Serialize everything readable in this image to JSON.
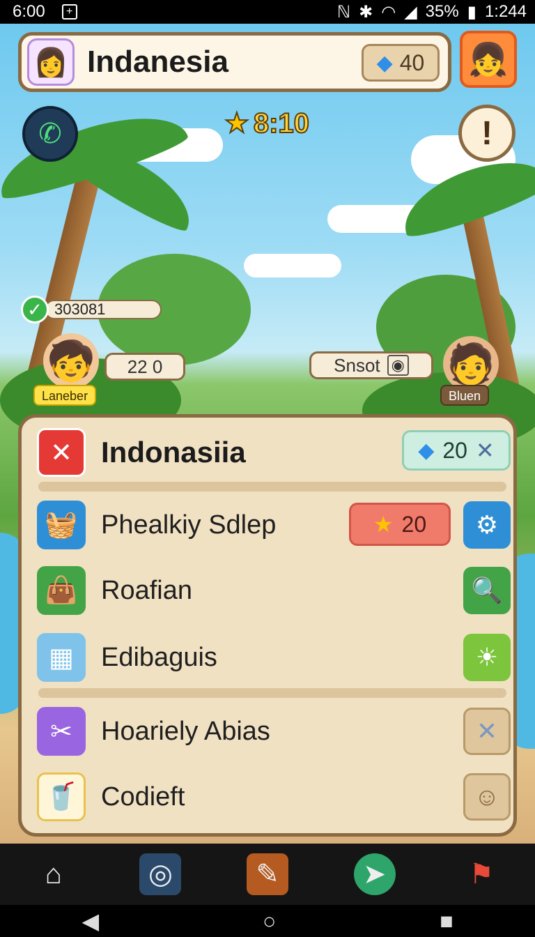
{
  "status_bar": {
    "time": "6:00",
    "plus_icon": "+",
    "battery": "35%",
    "clock": "1:244"
  },
  "header": {
    "title": "Indanesia",
    "gems": "40",
    "avatar_icon": "girl-avatar",
    "right_avatar_icon": "cat-girl-avatar"
  },
  "hud": {
    "timer": "8:10",
    "alert_symbol": "!"
  },
  "scene": {
    "score": "303081",
    "left_character": {
      "label": "Laneber",
      "bubble": "22 0"
    },
    "right_character": {
      "label": "Bluen",
      "bubble": "Snsot"
    }
  },
  "panel": {
    "title": "Indonasiia",
    "title_badge": "20",
    "rows": [
      {
        "label": "Phealkiy Sdlep",
        "badge": "20",
        "icon": "basket-icon",
        "action_icon": "gear-icon"
      },
      {
        "label": "Roafian",
        "icon": "bag-icon",
        "action_icon": "magnifier-icon"
      },
      {
        "label": "Edibaguis",
        "icon": "calendar-icon",
        "action_icon": "sun-creature-icon"
      },
      {
        "label": "Hoariely Abias",
        "icon": "tools-icon",
        "action_icon": "cross-icon"
      },
      {
        "label": "Codieft",
        "icon": "cup-icon",
        "action_icon": "person-icon"
      }
    ]
  },
  "colors": {
    "accent": "#8a6a43",
    "panel": "#f1e1c3",
    "sky": "#6ec9ef",
    "badge_red": "#f07b6b",
    "badge_green": "#cdeee0"
  }
}
